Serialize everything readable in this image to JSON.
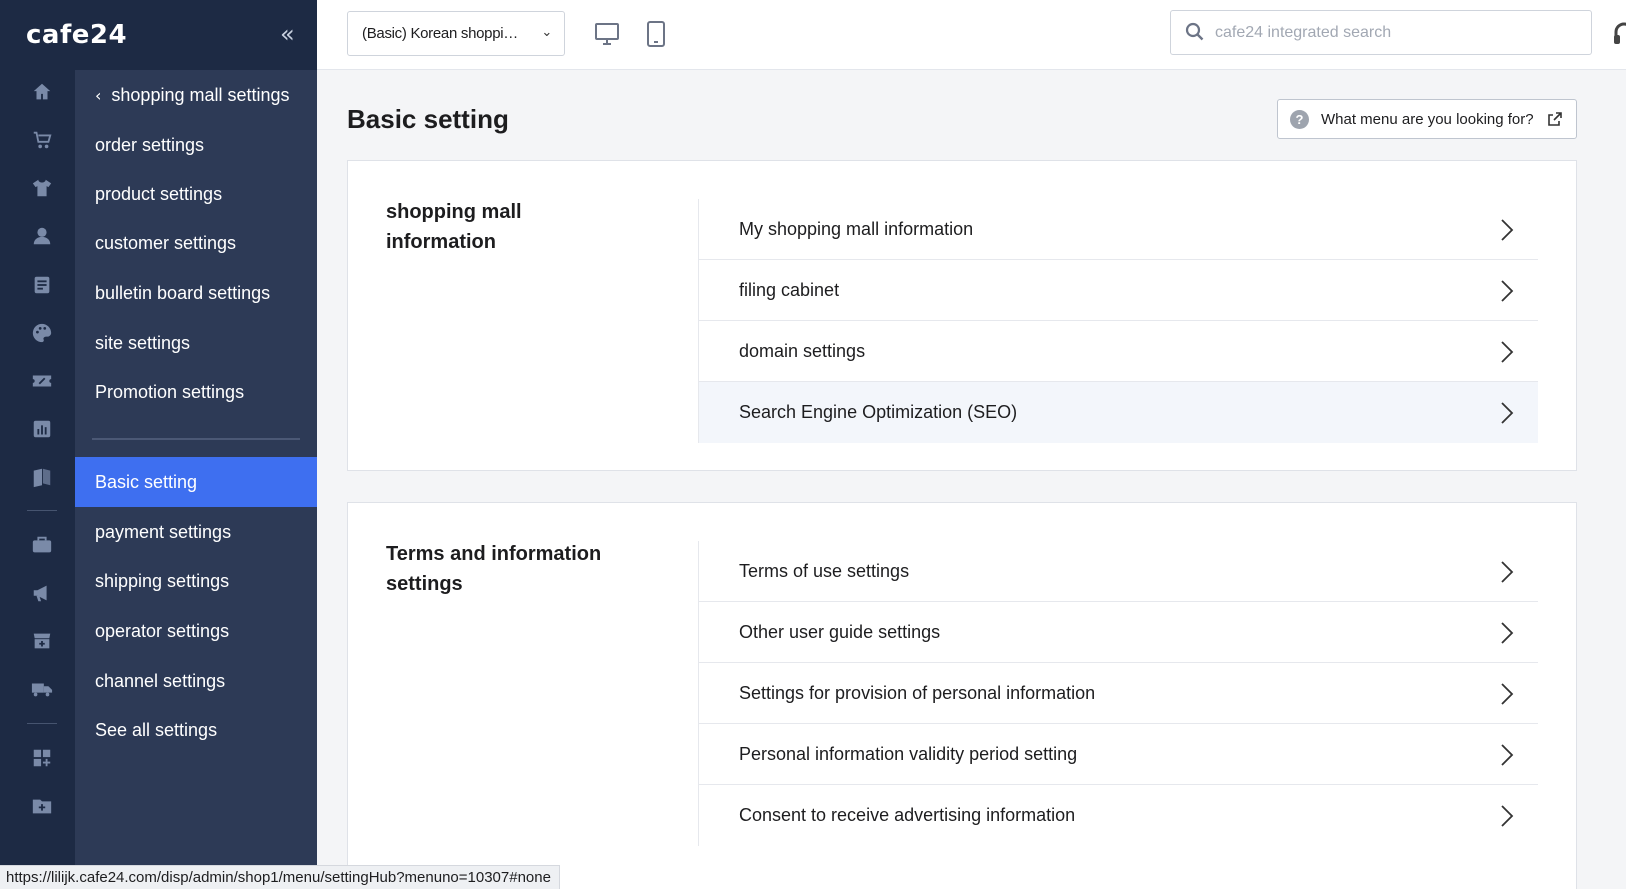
{
  "app": {
    "logo": "cafe24",
    "collapse_icon": "«"
  },
  "rail": {
    "icons": [
      "home-icon",
      "cart-icon",
      "tshirt-icon",
      "user-icon",
      "board-icon",
      "palette-icon",
      "coupon-icon",
      "chart-icon",
      "book-icon",
      "briefcase-icon",
      "megaphone-icon",
      "store-add-icon",
      "truck-icon",
      "apps-icon",
      "folder-add-icon"
    ]
  },
  "submenu": {
    "back_label": "shopping mall settings",
    "group1": [
      "order settings",
      "product settings",
      "customer settings",
      "bulletin board settings",
      "site settings",
      "Promotion settings"
    ],
    "group2": [
      "Basic setting",
      "payment settings",
      "shipping settings",
      "operator settings",
      "channel settings",
      "See all settings"
    ],
    "active": "Basic setting"
  },
  "topbar": {
    "shop_select": "(Basic) Korean shopping mall",
    "search_placeholder": "cafe24 integrated search"
  },
  "main": {
    "title": "Basic setting",
    "help_button": "What menu are you looking for?",
    "sections": [
      {
        "title": "shopping mall information",
        "items": [
          "My shopping mall information",
          "filing cabinet",
          "domain settings",
          "Search Engine Optimization (SEO)"
        ]
      },
      {
        "title": "Terms and information settings",
        "items": [
          "Terms of use settings",
          "Other user guide settings",
          "Settings for provision of personal information",
          "Personal information validity period setting",
          "Consent to receive advertising information"
        ]
      }
    ]
  },
  "statusbar": {
    "url": "https://lilijk.cafe24.com/disp/admin/shop1/menu/settingHub?menuno=10307#none"
  },
  "colors": {
    "rail_bg": "#1d2a44",
    "submenu_bg": "#2d3a56",
    "active_bg": "#3e6ff0"
  }
}
